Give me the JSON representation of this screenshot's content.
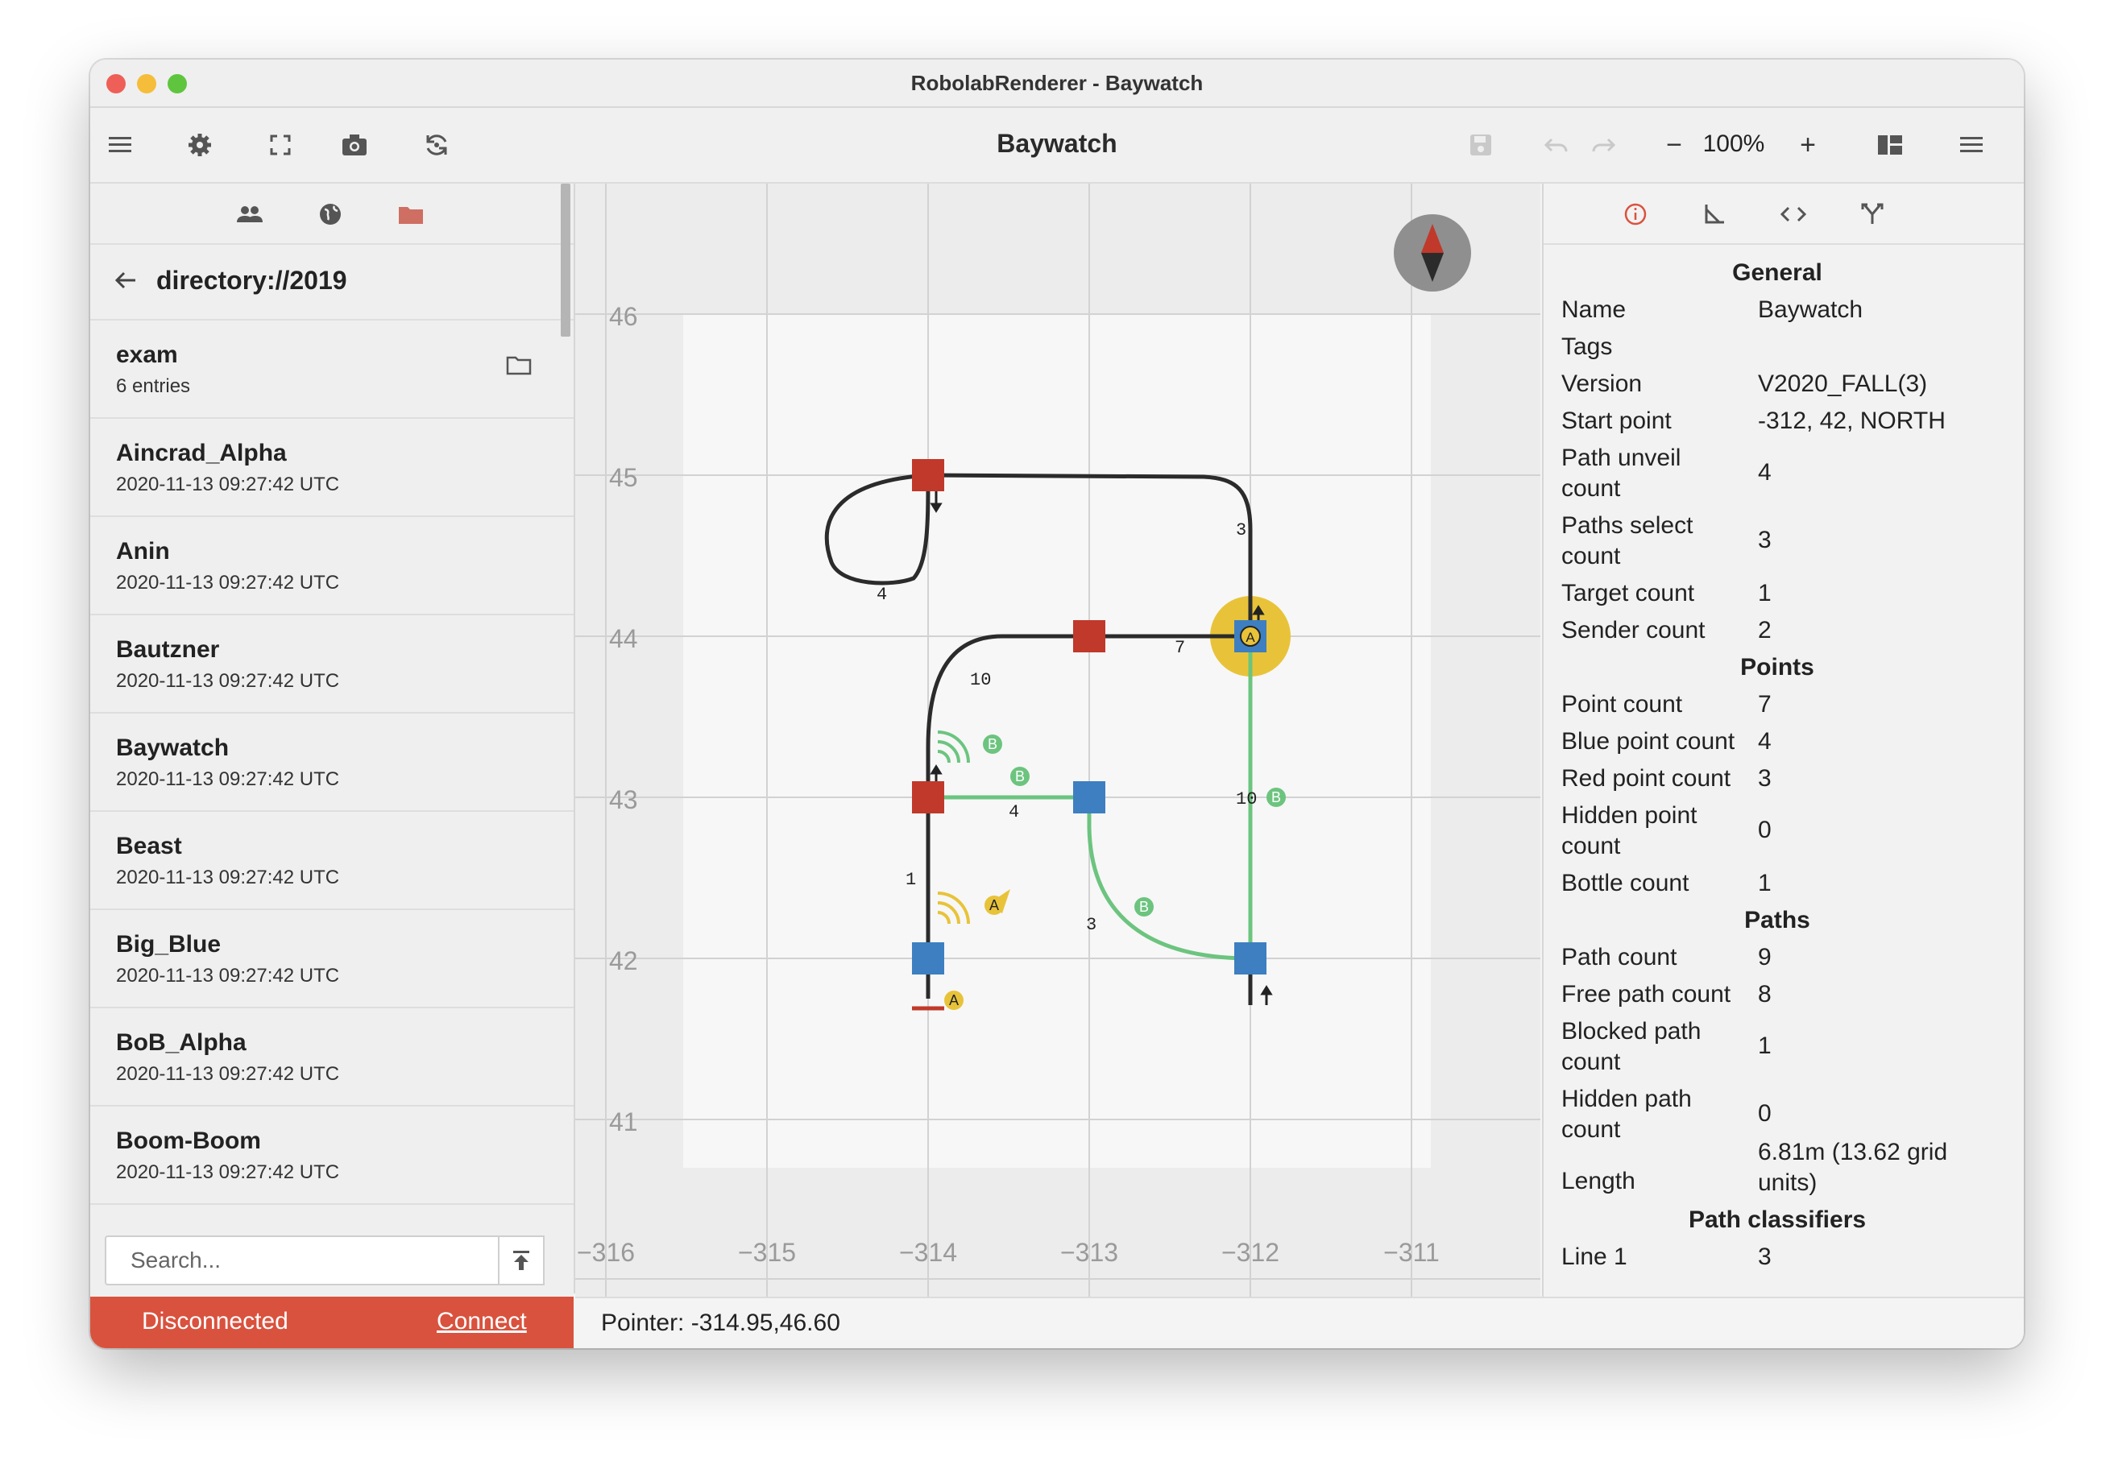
{
  "window": {
    "title": "RobolabRenderer - Baywatch"
  },
  "toolbar": {
    "doc_title": "Baywatch",
    "zoom": "100%",
    "zoom_out": "−",
    "zoom_in": "+"
  },
  "left_tabs": {
    "tab1": "people-icon",
    "tab2": "globe-icon",
    "tab3": "folder-icon"
  },
  "directory": {
    "path": "directory://2019"
  },
  "list": [
    {
      "name": "exam",
      "sub": "6 entries"
    },
    {
      "name": "Aincrad_Alpha",
      "sub": "2020-11-13 09:27:42 UTC"
    },
    {
      "name": "Anin",
      "sub": "2020-11-13 09:27:42 UTC"
    },
    {
      "name": "Bautzner",
      "sub": "2020-11-13 09:27:42 UTC"
    },
    {
      "name": "Baywatch",
      "sub": "2020-11-13 09:27:42 UTC"
    },
    {
      "name": "Beast",
      "sub": "2020-11-13 09:27:42 UTC"
    },
    {
      "name": "Big_Blue",
      "sub": "2020-11-13 09:27:42 UTC"
    },
    {
      "name": "BoB_Alpha",
      "sub": "2020-11-13 09:27:42 UTC"
    },
    {
      "name": "Boom-Boom",
      "sub": "2020-11-13 09:27:42 UTC"
    }
  ],
  "search": {
    "placeholder": "Search..."
  },
  "connection": {
    "status": "Disconnected",
    "action": "Connect"
  },
  "pointer": "Pointer: -314.95,46.60",
  "axes": {
    "y": [
      "46",
      "45",
      "44",
      "43",
      "42",
      "41"
    ],
    "x": [
      "−316",
      "−315",
      "−314",
      "−313",
      "−312",
      "−311"
    ]
  },
  "map_labels": {
    "top_loop": "4",
    "top_right": "3",
    "mid_top": "7",
    "curve": "10",
    "green_short": "4",
    "vertical": "1",
    "curve_low": "3",
    "green_right": "10",
    "sender_a": "A",
    "sender_b": "B"
  },
  "colors": {
    "red": "#c0392b",
    "blue": "#3d7fc1",
    "green": "#6cc47f",
    "yellow": "#e8c33a",
    "path": "#2b2b2b",
    "status_red": "#d9523e"
  },
  "info": {
    "general_title": "General",
    "general": [
      {
        "k": "Name",
        "v": "Baywatch"
      },
      {
        "k": "Tags",
        "v": ""
      },
      {
        "k": "Version",
        "v": "V2020_FALL(3)"
      },
      {
        "k": "Start point",
        "v": "-312, 42, NORTH"
      },
      {
        "k": "Path unveil count",
        "v": "4"
      },
      {
        "k": "Paths select count",
        "v": "3"
      },
      {
        "k": "Target count",
        "v": "1"
      },
      {
        "k": "Sender count",
        "v": "2"
      }
    ],
    "points_title": "Points",
    "points": [
      {
        "k": "Point count",
        "v": "7"
      },
      {
        "k": "Blue point count",
        "v": "4"
      },
      {
        "k": "Red point count",
        "v": "3"
      },
      {
        "k": "Hidden point count",
        "v": "0"
      },
      {
        "k": "Bottle count",
        "v": "1"
      }
    ],
    "paths_title": "Paths",
    "paths": [
      {
        "k": "Path count",
        "v": "9"
      },
      {
        "k": "Free path count",
        "v": "8"
      },
      {
        "k": "Blocked path count",
        "v": "1"
      },
      {
        "k": "Hidden path count",
        "v": "0"
      },
      {
        "k": "Length",
        "v": "6.81m (13.62 grid units)"
      }
    ],
    "classifiers_title": "Path classifiers",
    "classifiers": [
      {
        "k": "Line 1",
        "v": "3"
      }
    ]
  }
}
